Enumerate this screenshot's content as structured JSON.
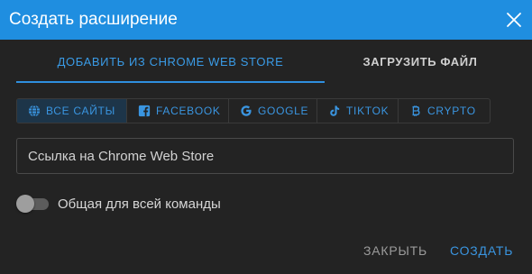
{
  "header": {
    "title": "Создать расширение"
  },
  "tabs": [
    {
      "label": "ДОБАВИТЬ ИЗ CHROME WEB STORE",
      "active": true
    },
    {
      "label": "ЗАГРУЗИТЬ ФАЙЛ",
      "active": false
    }
  ],
  "filters": [
    {
      "label": "ВСЕ САЙТЫ",
      "icon": "globe-icon",
      "active": true
    },
    {
      "label": "FACEBOOK",
      "icon": "facebook-icon",
      "active": false
    },
    {
      "label": "GOOGLE",
      "icon": "google-icon",
      "active": false
    },
    {
      "label": "TIKTOK",
      "icon": "tiktok-icon",
      "active": false
    },
    {
      "label": "CRYPTO",
      "icon": "bitcoin-icon",
      "active": false
    }
  ],
  "url_input": {
    "placeholder": "Ссылка на Chrome Web Store",
    "value": ""
  },
  "shared_toggle": {
    "label": "Общая для всей команды",
    "checked": false
  },
  "footer": {
    "close_label": "ЗАКРЫТЬ",
    "create_label": "СОЗДАТЬ"
  },
  "colors": {
    "accent": "#1f8ee0",
    "background": "#232323",
    "link": "#3a95e0"
  }
}
